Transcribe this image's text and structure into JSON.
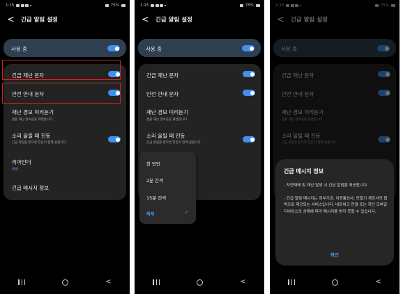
{
  "status_bar": {
    "time": "1:15",
    "battery": "75%"
  },
  "header": {
    "back_glyph": "<",
    "title": "긴급 알림 설정"
  },
  "master": {
    "label": "사용 중",
    "enabled": true
  },
  "settings": {
    "disaster_text": {
      "label": "긴급 재난 문자",
      "enabled": true
    },
    "safety_text": {
      "label": "안전 안내 문자",
      "enabled": true
    },
    "preview": {
      "label": "재난 경보 미리듣기",
      "sub": "샘플 재난 경보음을 재생합니다."
    },
    "vibrate": {
      "label": "소리 울릴 때 진동",
      "sub": "긴급 알림을 받으면 진동이 함께 울립니다.",
      "enabled": true
    },
    "reminder": {
      "label": "리마인더",
      "value": "해제"
    },
    "info": {
      "label": "긴급 메시지 정보"
    }
  },
  "reminder_menu": {
    "options": [
      "한 번만",
      "2분 간격",
      "15분 간격",
      "해제"
    ],
    "selected": "해제",
    "check_glyph": "✓"
  },
  "dialog": {
    "title": "긴급 메시지 정보",
    "paragraph1": "- 자연재해 및 재난 발생 시 긴급 알림을 제공합니다.",
    "paragraph2": "- 긴급 알림 메시지는 정부기관, 이동통신사, 단말기 제조사의 협력으로 제공되는 서비스입니다. 네트워크 연결 또는 개인 모바일 디바이스의 상태에 따라 메시지를 받지 못할 수 있습니다.",
    "ok_label": "확인"
  },
  "navbar": {
    "back_glyph": "<"
  },
  "colors": {
    "accent": "#3e91ef",
    "highlight_box": "#e02020",
    "card": "#232323",
    "master_card": "#2f3e50"
  }
}
